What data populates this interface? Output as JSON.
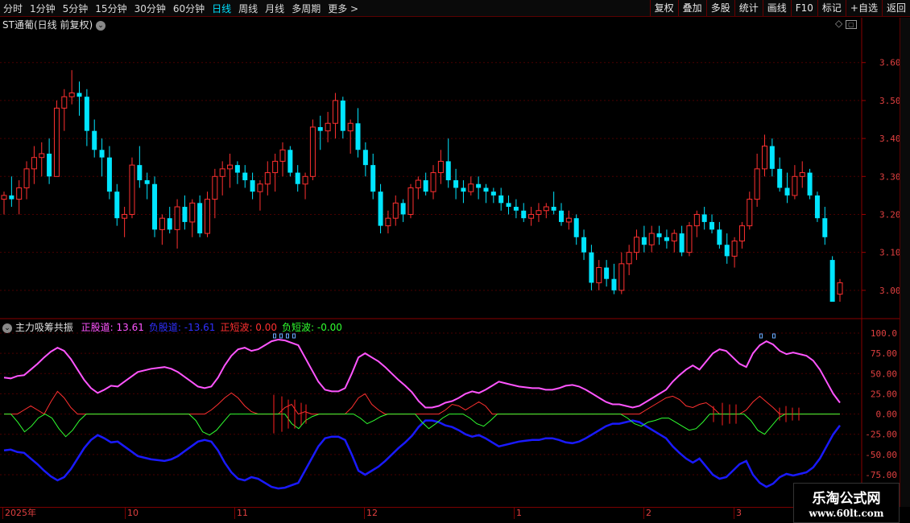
{
  "toolbar": {
    "periods": [
      "分时",
      "1分钟",
      "5分钟",
      "15分钟",
      "30分钟",
      "60分钟",
      "日线",
      "周线",
      "月线",
      "多周期",
      "更多 >"
    ],
    "active_period": "日线",
    "right_buttons": [
      "复权",
      "叠加",
      "多股",
      "统计",
      "画线",
      "F10",
      "标记",
      "+自选",
      "返回"
    ]
  },
  "main_panel": {
    "title": "ST通葡(日线 前复权)",
    "icons": [
      "settings-icon",
      "diamond-icon",
      "window-icon"
    ],
    "price_ticks": [
      "3.60",
      "3.50",
      "3.40",
      "3.30",
      "3.20",
      "3.10",
      "3.00"
    ]
  },
  "indicator_panel": {
    "name": "主力吸筹共振",
    "labels": [
      {
        "text": "正股道: 13.61",
        "color": "#ff55ff"
      },
      {
        "text": "负股道: -13.61",
        "color": "#3030ff"
      },
      {
        "text": "正短波: 0.00",
        "color": "#ff3030"
      },
      {
        "text": "负短波: -0.00",
        "color": "#30ff30"
      }
    ],
    "ticks": [
      "100.0",
      "75.00",
      "50.00",
      "25.00",
      "0.00",
      "-25.00",
      "-50.00",
      "-75.00"
    ]
  },
  "date_axis": [
    "2025年",
    "10",
    "11",
    "12",
    "1",
    "2",
    "3"
  ],
  "watermark": {
    "line1": "乐淘公式网",
    "line2": "www.60lt.com"
  },
  "colors": {
    "up": "#ff3030",
    "down": "#00e5ff",
    "pink": "#ff55ff",
    "blue": "#1a1aff",
    "green": "#30ff30",
    "red": "#ff3030",
    "grid": "#4a0000"
  },
  "chart_data": [
    {
      "type": "candlestick",
      "title": "ST通葡(日线 前复权)",
      "ylim": [
        2.97,
        3.68
      ],
      "candles": [
        [
          3.24,
          3.26,
          3.2,
          3.25
        ],
        [
          3.25,
          3.3,
          3.22,
          3.24
        ],
        [
          3.24,
          3.29,
          3.2,
          3.27
        ],
        [
          3.27,
          3.34,
          3.24,
          3.32
        ],
        [
          3.32,
          3.38,
          3.28,
          3.35
        ],
        [
          3.35,
          3.39,
          3.3,
          3.36
        ],
        [
          3.36,
          3.4,
          3.28,
          3.3
        ],
        [
          3.3,
          3.5,
          3.3,
          3.48
        ],
        [
          3.48,
          3.53,
          3.42,
          3.51
        ],
        [
          3.51,
          3.58,
          3.49,
          3.52
        ],
        [
          3.52,
          3.55,
          3.46,
          3.51
        ],
        [
          3.51,
          3.53,
          3.38,
          3.42
        ],
        [
          3.42,
          3.45,
          3.35,
          3.37
        ],
        [
          3.37,
          3.4,
          3.3,
          3.35
        ],
        [
          3.35,
          3.38,
          3.24,
          3.26
        ],
        [
          3.26,
          3.28,
          3.17,
          3.19
        ],
        [
          3.19,
          3.22,
          3.14,
          3.2
        ],
        [
          3.2,
          3.35,
          3.19,
          3.33
        ],
        [
          3.33,
          3.38,
          3.27,
          3.29
        ],
        [
          3.29,
          3.31,
          3.24,
          3.28
        ],
        [
          3.28,
          3.3,
          3.14,
          3.16
        ],
        [
          3.16,
          3.2,
          3.12,
          3.19
        ],
        [
          3.19,
          3.22,
          3.15,
          3.16
        ],
        [
          3.16,
          3.24,
          3.11,
          3.22
        ],
        [
          3.22,
          3.25,
          3.16,
          3.18
        ],
        [
          3.18,
          3.24,
          3.14,
          3.23
        ],
        [
          3.23,
          3.25,
          3.14,
          3.15
        ],
        [
          3.15,
          3.26,
          3.14,
          3.24
        ],
        [
          3.24,
          3.32,
          3.19,
          3.3
        ],
        [
          3.3,
          3.34,
          3.25,
          3.32
        ],
        [
          3.32,
          3.36,
          3.27,
          3.33
        ],
        [
          3.33,
          3.34,
          3.28,
          3.31
        ],
        [
          3.31,
          3.33,
          3.27,
          3.29
        ],
        [
          3.29,
          3.31,
          3.24,
          3.26
        ],
        [
          3.26,
          3.29,
          3.21,
          3.28
        ],
        [
          3.28,
          3.34,
          3.25,
          3.31
        ],
        [
          3.31,
          3.36,
          3.26,
          3.34
        ],
        [
          3.34,
          3.39,
          3.3,
          3.37
        ],
        [
          3.37,
          3.38,
          3.3,
          3.31
        ],
        [
          3.31,
          3.33,
          3.26,
          3.28
        ],
        [
          3.28,
          3.31,
          3.24,
          3.3
        ],
        [
          3.3,
          3.45,
          3.29,
          3.43
        ],
        [
          3.43,
          3.46,
          3.37,
          3.42
        ],
        [
          3.42,
          3.47,
          3.39,
          3.44
        ],
        [
          3.44,
          3.52,
          3.4,
          3.5
        ],
        [
          3.5,
          3.51,
          3.4,
          3.42
        ],
        [
          3.42,
          3.45,
          3.36,
          3.44
        ],
        [
          3.44,
          3.48,
          3.35,
          3.37
        ],
        [
          3.37,
          3.39,
          3.3,
          3.33
        ],
        [
          3.33,
          3.36,
          3.24,
          3.26
        ],
        [
          3.26,
          3.28,
          3.15,
          3.17
        ],
        [
          3.17,
          3.21,
          3.15,
          3.19
        ],
        [
          3.19,
          3.25,
          3.17,
          3.23
        ],
        [
          3.23,
          3.24,
          3.18,
          3.2
        ],
        [
          3.2,
          3.28,
          3.19,
          3.27
        ],
        [
          3.27,
          3.3,
          3.24,
          3.29
        ],
        [
          3.29,
          3.31,
          3.25,
          3.26
        ],
        [
          3.26,
          3.33,
          3.24,
          3.31
        ],
        [
          3.31,
          3.37,
          3.28,
          3.34
        ],
        [
          3.34,
          3.4,
          3.27,
          3.29
        ],
        [
          3.29,
          3.32,
          3.24,
          3.27
        ],
        [
          3.27,
          3.29,
          3.23,
          3.26
        ],
        [
          3.26,
          3.3,
          3.25,
          3.28
        ],
        [
          3.28,
          3.3,
          3.24,
          3.27
        ],
        [
          3.27,
          3.28,
          3.23,
          3.26
        ],
        [
          3.26,
          3.27,
          3.23,
          3.25
        ],
        [
          3.25,
          3.27,
          3.21,
          3.23
        ],
        [
          3.23,
          3.25,
          3.2,
          3.22
        ],
        [
          3.22,
          3.24,
          3.19,
          3.21
        ],
        [
          3.21,
          3.23,
          3.18,
          3.19
        ],
        [
          3.19,
          3.22,
          3.17,
          3.2
        ],
        [
          3.2,
          3.23,
          3.18,
          3.21
        ],
        [
          3.21,
          3.23,
          3.19,
          3.22
        ],
        [
          3.22,
          3.26,
          3.2,
          3.21
        ],
        [
          3.21,
          3.23,
          3.17,
          3.18
        ],
        [
          3.18,
          3.21,
          3.16,
          3.19
        ],
        [
          3.19,
          3.2,
          3.12,
          3.14
        ],
        [
          3.14,
          3.16,
          3.08,
          3.1
        ],
        [
          3.1,
          3.12,
          3.0,
          3.02
        ],
        [
          3.02,
          3.08,
          3.0,
          3.06
        ],
        [
          3.06,
          3.08,
          3.01,
          3.03
        ],
        [
          3.03,
          3.07,
          2.99,
          3.0
        ],
        [
          3.0,
          3.1,
          2.99,
          3.07
        ],
        [
          3.07,
          3.12,
          3.04,
          3.1
        ],
        [
          3.1,
          3.16,
          3.08,
          3.14
        ],
        [
          3.14,
          3.17,
          3.1,
          3.12
        ],
        [
          3.12,
          3.17,
          3.1,
          3.15
        ],
        [
          3.15,
          3.17,
          3.12,
          3.14
        ],
        [
          3.14,
          3.16,
          3.11,
          3.13
        ],
        [
          3.13,
          3.16,
          3.1,
          3.15
        ],
        [
          3.15,
          3.17,
          3.09,
          3.1
        ],
        [
          3.1,
          3.18,
          3.09,
          3.17
        ],
        [
          3.17,
          3.21,
          3.14,
          3.2
        ],
        [
          3.2,
          3.22,
          3.16,
          3.18
        ],
        [
          3.18,
          3.2,
          3.15,
          3.16
        ],
        [
          3.16,
          3.18,
          3.11,
          3.12
        ],
        [
          3.12,
          3.15,
          3.07,
          3.09
        ],
        [
          3.09,
          3.14,
          3.06,
          3.13
        ],
        [
          3.13,
          3.18,
          3.11,
          3.17
        ],
        [
          3.17,
          3.26,
          3.16,
          3.24
        ],
        [
          3.24,
          3.36,
          3.22,
          3.32
        ],
        [
          3.32,
          3.41,
          3.3,
          3.38
        ],
        [
          3.38,
          3.4,
          3.3,
          3.32
        ],
        [
          3.32,
          3.35,
          3.26,
          3.27
        ],
        [
          3.27,
          3.31,
          3.23,
          3.25
        ],
        [
          3.25,
          3.33,
          3.24,
          3.3
        ],
        [
          3.3,
          3.34,
          3.27,
          3.31
        ],
        [
          3.31,
          3.32,
          3.24,
          3.25
        ],
        [
          3.25,
          3.26,
          3.18,
          3.19
        ],
        [
          3.19,
          3.22,
          3.12,
          3.14
        ],
        [
          3.08,
          3.09,
          2.97,
          2.97
        ],
        [
          2.99,
          3.03,
          2.97,
          3.02
        ]
      ]
    },
    {
      "type": "line",
      "title": "主力吸筹共振",
      "ylim": [
        -100,
        110
      ],
      "series": [
        {
          "name": "正股道",
          "values": [
            45,
            44,
            47,
            48,
            55,
            62,
            70,
            77,
            82,
            78,
            68,
            55,
            42,
            32,
            26,
            30,
            35,
            34,
            40,
            46,
            52,
            54,
            56,
            57,
            58,
            56,
            52,
            46,
            40,
            34,
            32,
            34,
            45,
            60,
            72,
            80,
            82,
            78,
            80,
            85,
            90,
            92,
            91,
            88,
            85,
            70,
            55,
            40,
            30,
            28,
            28,
            32,
            50,
            70,
            75,
            70,
            65,
            58,
            50,
            42,
            35,
            27,
            16,
            8,
            8,
            10,
            14,
            16,
            20,
            25,
            28,
            26,
            30,
            35,
            40,
            38,
            36,
            34,
            33,
            32,
            32,
            30,
            30,
            32,
            35,
            36,
            34,
            30,
            25,
            20,
            15,
            12,
            12,
            10,
            8,
            10,
            15,
            20,
            25,
            30,
            40,
            48,
            55,
            60,
            55,
            65,
            75,
            80,
            78,
            70,
            62,
            58,
            75,
            85,
            90,
            86,
            78,
            74,
            76,
            74,
            72,
            66,
            55,
            40,
            25,
            14
          ]
        },
        {
          "name": "负股道",
          "values": [
            -45,
            -44,
            -47,
            -48,
            -55,
            -62,
            -70,
            -77,
            -82,
            -78,
            -68,
            -55,
            -42,
            -32,
            -26,
            -30,
            -35,
            -34,
            -40,
            -46,
            -52,
            -54,
            -56,
            -57,
            -58,
            -56,
            -52,
            -46,
            -40,
            -34,
            -32,
            -34,
            -45,
            -60,
            -72,
            -80,
            -82,
            -78,
            -80,
            -85,
            -90,
            -92,
            -91,
            -88,
            -85,
            -70,
            -55,
            -40,
            -30,
            -28,
            -28,
            -32,
            -50,
            -70,
            -75,
            -70,
            -65,
            -58,
            -50,
            -42,
            -35,
            -27,
            -16,
            -8,
            -8,
            -10,
            -14,
            -16,
            -20,
            -25,
            -28,
            -26,
            -30,
            -35,
            -40,
            -38,
            -36,
            -34,
            -33,
            -32,
            -32,
            -30,
            -30,
            -32,
            -35,
            -36,
            -34,
            -30,
            -25,
            -20,
            -15,
            -12,
            -12,
            -10,
            -8,
            -10,
            -15,
            -20,
            -25,
            -30,
            -40,
            -48,
            -55,
            -60,
            -55,
            -65,
            -75,
            -80,
            -78,
            -70,
            -62,
            -58,
            -75,
            -85,
            -90,
            -86,
            -78,
            -74,
            -76,
            -74,
            -72,
            -66,
            -55,
            -40,
            -25,
            -14
          ]
        },
        {
          "name": "正短波",
          "values": [
            0,
            0,
            0,
            5,
            10,
            5,
            0,
            15,
            28,
            20,
            8,
            0,
            0,
            0,
            0,
            0,
            0,
            0,
            0,
            0,
            0,
            0,
            0,
            0,
            0,
            0,
            0,
            0,
            0,
            0,
            0,
            5,
            12,
            20,
            26,
            20,
            10,
            3,
            0,
            0,
            0,
            0,
            8,
            12,
            0,
            3,
            0,
            0,
            0,
            0,
            0,
            0,
            8,
            20,
            25,
            12,
            5,
            0,
            0,
            0,
            0,
            0,
            0,
            0,
            0,
            0,
            5,
            12,
            10,
            5,
            10,
            15,
            10,
            0,
            0,
            0,
            0,
            0,
            0,
            0,
            0,
            0,
            0,
            0,
            0,
            0,
            0,
            0,
            0,
            0,
            0,
            0,
            0,
            0,
            0,
            0,
            5,
            10,
            15,
            20,
            22,
            18,
            10,
            8,
            12,
            14,
            8,
            0,
            0,
            0,
            0,
            5,
            15,
            22,
            15,
            8,
            0,
            0,
            0,
            0,
            0,
            0,
            0,
            0,
            0,
            0
          ]
        },
        {
          "name": "负短波",
          "values": [
            0,
            0,
            -10,
            -22,
            -15,
            -5,
            0,
            -5,
            -18,
            -28,
            -20,
            -8,
            0,
            0,
            0,
            0,
            0,
            0,
            0,
            0,
            0,
            0,
            0,
            0,
            0,
            0,
            0,
            0,
            -8,
            -22,
            -26,
            -20,
            -10,
            0,
            0,
            0,
            0,
            0,
            0,
            0,
            0,
            0,
            -12,
            -18,
            -8,
            -3,
            0,
            0,
            0,
            0,
            0,
            0,
            -5,
            -12,
            -8,
            -3,
            0,
            0,
            0,
            0,
            0,
            -10,
            -18,
            -12,
            -5,
            0,
            0,
            0,
            -5,
            -12,
            -15,
            -8,
            0,
            0,
            0,
            0,
            0,
            0,
            0,
            0,
            0,
            0,
            0,
            0,
            0,
            0,
            0,
            0,
            0,
            0,
            0,
            -5,
            -12,
            -15,
            -10,
            -8,
            -5,
            -5,
            -10,
            -15,
            -20,
            -18,
            -10,
            0,
            0,
            0,
            0,
            0,
            0,
            -8,
            -20,
            -25,
            -15,
            -5,
            0,
            0,
            0,
            0,
            0,
            0,
            0,
            0,
            0
          ]
        }
      ]
    }
  ]
}
